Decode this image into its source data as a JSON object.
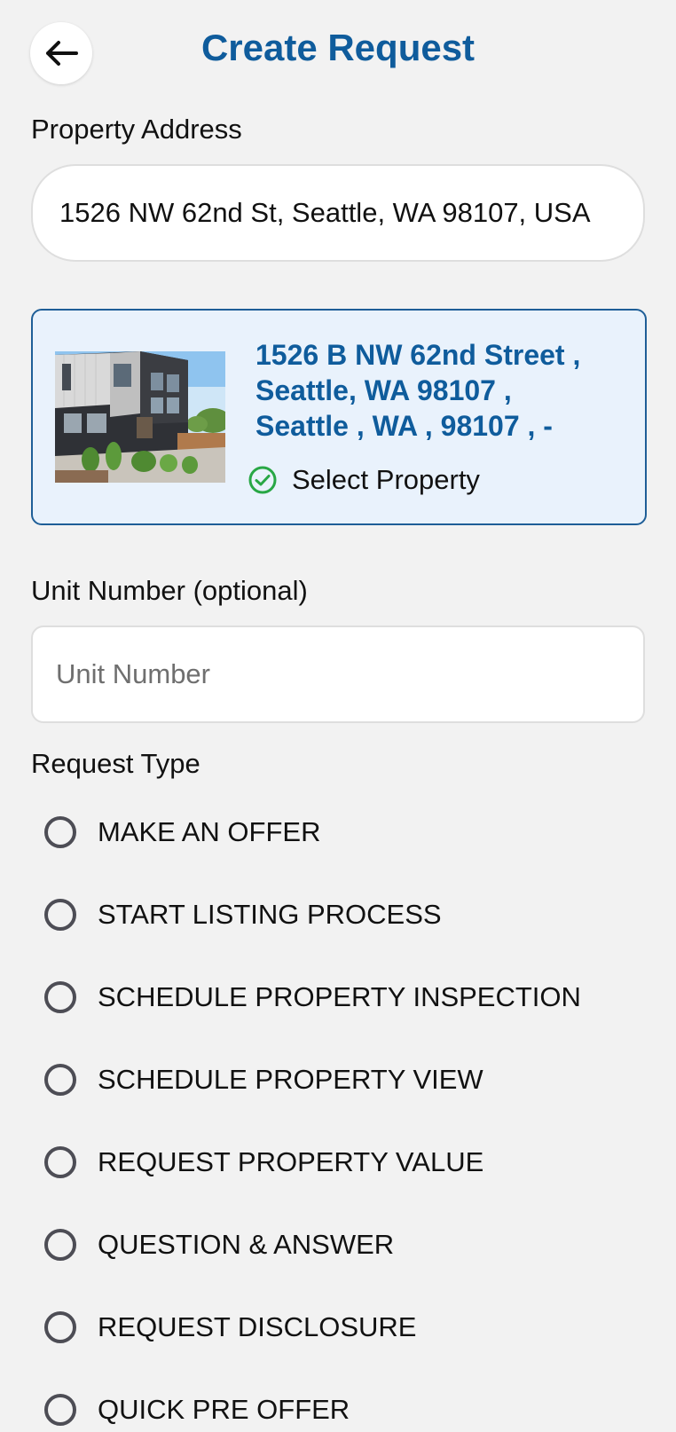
{
  "header": {
    "title": "Create Request",
    "back_icon": "arrow-left-icon"
  },
  "address": {
    "label": "Property Address",
    "value": "1526 NW 62nd St, Seattle, WA 98107, USA"
  },
  "property_card": {
    "address_line1": "1526 B NW 62nd Street ,",
    "address_line2": "Seattle, WA 98107 ,",
    "address_line3": "Seattle , WA , 98107 , -",
    "select_label": "Select Property",
    "select_icon": "check-circle-icon",
    "accent_color": "#0f5c9c",
    "check_color": "#28a745"
  },
  "unit": {
    "label": "Unit Number (optional)",
    "placeholder": "Unit Number",
    "value": ""
  },
  "request_type": {
    "label": "Request Type",
    "options": [
      {
        "label": "MAKE AN OFFER",
        "selected": false
      },
      {
        "label": "START LISTING PROCESS",
        "selected": false
      },
      {
        "label": "SCHEDULE PROPERTY INSPECTION",
        "selected": false
      },
      {
        "label": "SCHEDULE PROPERTY VIEW",
        "selected": false
      },
      {
        "label": "REQUEST PROPERTY VALUE",
        "selected": false
      },
      {
        "label": "QUESTION & ANSWER",
        "selected": false
      },
      {
        "label": "REQUEST DISCLOSURE",
        "selected": false
      },
      {
        "label": "QUICK PRE OFFER",
        "selected": false
      }
    ]
  }
}
